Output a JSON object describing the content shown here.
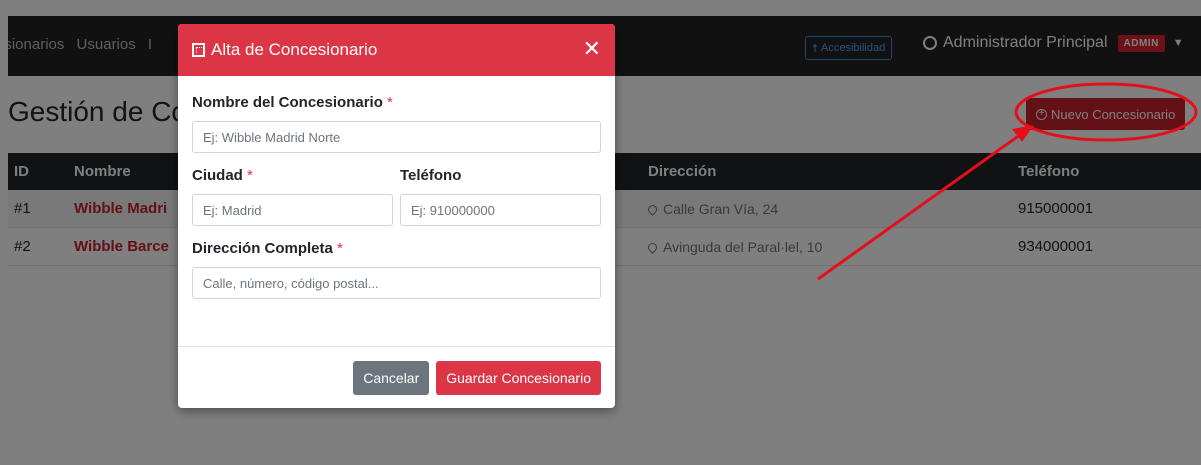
{
  "nav": {
    "links": [
      "esionarios",
      "Usuarios",
      "I"
    ],
    "accessibility_label": "Accesibilidad",
    "user_name": "Administrador Principal",
    "role_badge": "ADMIN"
  },
  "page": {
    "title": "Gestión de Co",
    "new_button": "Nuevo Concesionario"
  },
  "table": {
    "headers": [
      "ID",
      "Nombre",
      "Dirección",
      "Teléfono"
    ],
    "rows": [
      {
        "id": "#1",
        "name": "Wibble Madri",
        "address": "Calle Gran Vía, 24",
        "phone": "915000001"
      },
      {
        "id": "#2",
        "name": "Wibble Barce",
        "address": "Avinguda del Paral·lel, 10",
        "phone": "934000001"
      }
    ]
  },
  "modal": {
    "title": "Alta de Concesionario",
    "name_label": "Nombre del Concesionario",
    "name_placeholder": "Ej: Wibble Madrid Norte",
    "city_label": "Ciudad",
    "city_placeholder": "Ej: Madrid",
    "phone_label": "Teléfono",
    "phone_placeholder": "Ej: 910000000",
    "address_label": "Dirección Completa",
    "address_placeholder": "Calle, número, código postal...",
    "required_mark": "*",
    "cancel_label": "Cancelar",
    "save_label": "Guardar Concesionario"
  },
  "colors": {
    "brand_red": "#dc3545",
    "annotation_red": "#e3101c",
    "navbar": "#222222"
  }
}
